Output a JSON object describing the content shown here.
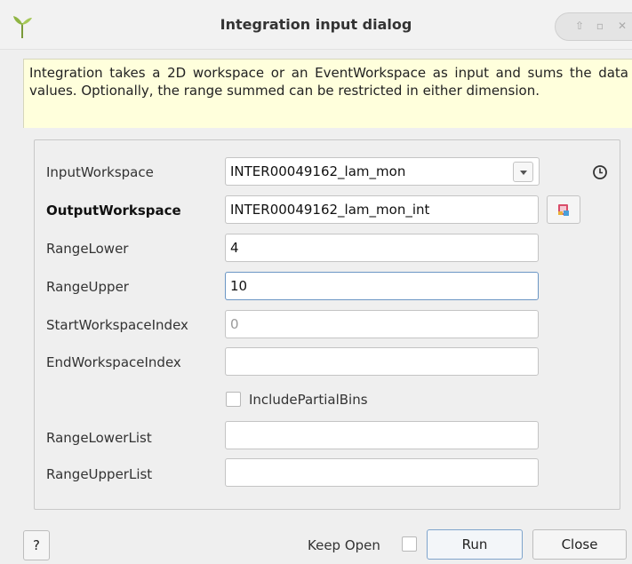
{
  "window": {
    "title": "Integration input dialog",
    "controls": [
      "⇧",
      "▫",
      "✕"
    ],
    "app_icon": "mantid-plant-icon"
  },
  "description": "Integration takes a 2D workspace or an EventWorkspace as input and sums the data values. Optionally, the range summed can be restricted in either dimension.",
  "properties": {
    "input_workspace": {
      "label": "InputWorkspace",
      "value": "INTER00049162_lam_mon"
    },
    "output_workspace": {
      "label": "OutputWorkspace",
      "value": "INTER00049162_lam_mon_int"
    },
    "range_lower": {
      "label": "RangeLower",
      "value": "4"
    },
    "range_upper": {
      "label": "RangeUpper",
      "value": "10"
    },
    "start_ws_index": {
      "label": "StartWorkspaceIndex",
      "value": "",
      "placeholder": "0"
    },
    "end_ws_index": {
      "label": "EndWorkspaceIndex",
      "value": ""
    },
    "include_partial": {
      "label": "IncludePartialBins",
      "checked": false
    },
    "range_lower_list": {
      "label": "RangeLowerList",
      "value": ""
    },
    "range_upper_list": {
      "label": "RangeUpperList",
      "value": ""
    }
  },
  "footer": {
    "help_label": "?",
    "keep_open_label": "Keep Open",
    "keep_open_checked": false,
    "run_label": "Run",
    "close_label": "Close"
  },
  "colors": {
    "description_bg": "#ffffdc",
    "focus_border": "#6b96c4",
    "window_bg": "#efefef"
  }
}
